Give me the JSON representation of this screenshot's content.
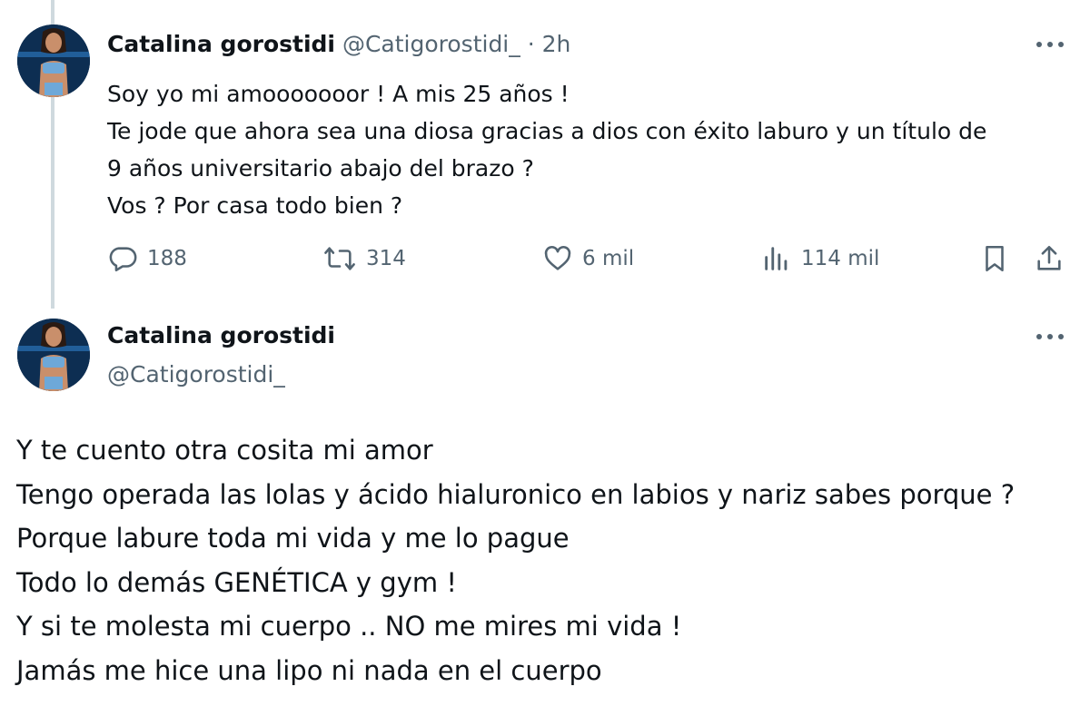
{
  "tweet1": {
    "name": "Catalina gorostidi",
    "handle_time": "@Catigorostidi_ · 2h",
    "lines": [
      "Soy yo mi amooooooor ! A mis 25 años !",
      "Te jode que ahora sea una diosa gracias a dios con éxito laburo y un título de",
      "9 años universitario abajo del brazo ?",
      "Vos ? Por casa todo bien ?"
    ],
    "actions": {
      "replies": "188",
      "reposts": "314",
      "likes": "6 mil",
      "views": "114 mil"
    }
  },
  "tweet2": {
    "name": "Catalina gorostidi",
    "handle": "@Catigorostidi_",
    "lines": [
      "Y te cuento otra cosita mi amor",
      "Tengo operada las lolas y ácido hialuronico en labios y nariz sabes porque ?",
      "Porque labure toda mi vida y me lo pague",
      "Todo lo demás GENÉTICA y gym !",
      "Y si te molesta mi cuerpo .. NO me mires mi vida !",
      "Jamás me hice una lipo ni nada en el cuerpo"
    ]
  },
  "icons": {
    "reply": "speech-bubble-icon",
    "repost": "repost-arrows-icon",
    "like": "heart-icon",
    "views": "bar-chart-icon",
    "bookmark": "bookmark-icon",
    "share": "share-upload-icon",
    "more": "three-dots-icon"
  },
  "colors": {
    "text": "#0f1419",
    "secondary": "#536471",
    "thread_line": "#cfd9de"
  }
}
